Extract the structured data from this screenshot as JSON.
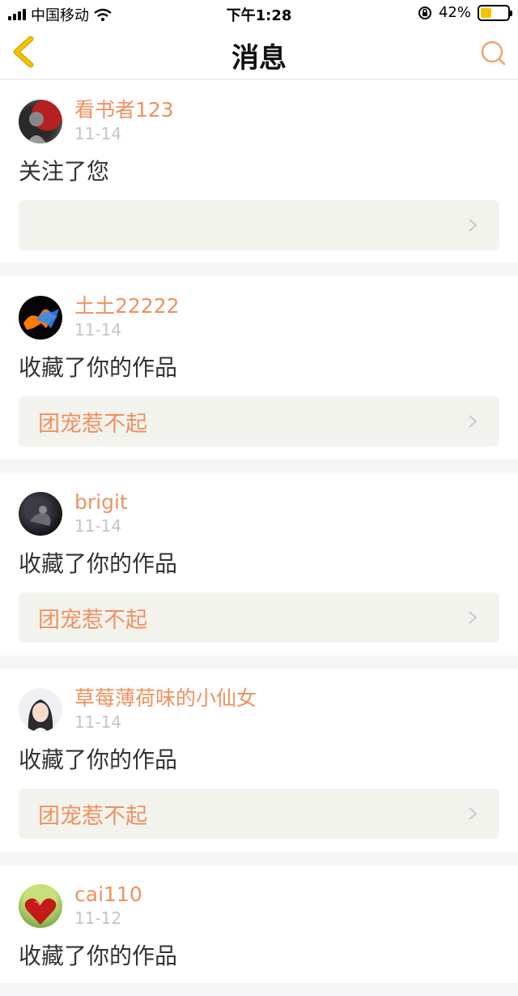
{
  "status_bar": {
    "carrier": "中国移动",
    "time": "下午1:28",
    "battery_percent": "42%",
    "battery_level": 0.42
  },
  "nav": {
    "title": "消息",
    "back_icon": "back-chevron-icon",
    "search_icon": "search-icon",
    "accent_color": "#f2c400"
  },
  "colors": {
    "username": "#ef915f",
    "work_box_bg": "#f3f3ee",
    "date": "#c4c4c4"
  },
  "messages": [
    {
      "username": "看书者123",
      "date": "11-14",
      "action": "关注了您",
      "work_title": ""
    },
    {
      "username": "土土22222",
      "date": "11-14",
      "action": "收藏了你的作品",
      "work_title": "团宠惹不起"
    },
    {
      "username": "brigit",
      "date": "11-14",
      "action": "收藏了你的作品",
      "work_title": "团宠惹不起"
    },
    {
      "username": "草莓薄荷味的小仙女",
      "date": "11-14",
      "action": "收藏了你的作品",
      "work_title": "团宠惹不起"
    },
    {
      "username": "cai110",
      "date": "11-12",
      "action": "收藏了你的作品",
      "work_title": ""
    }
  ]
}
